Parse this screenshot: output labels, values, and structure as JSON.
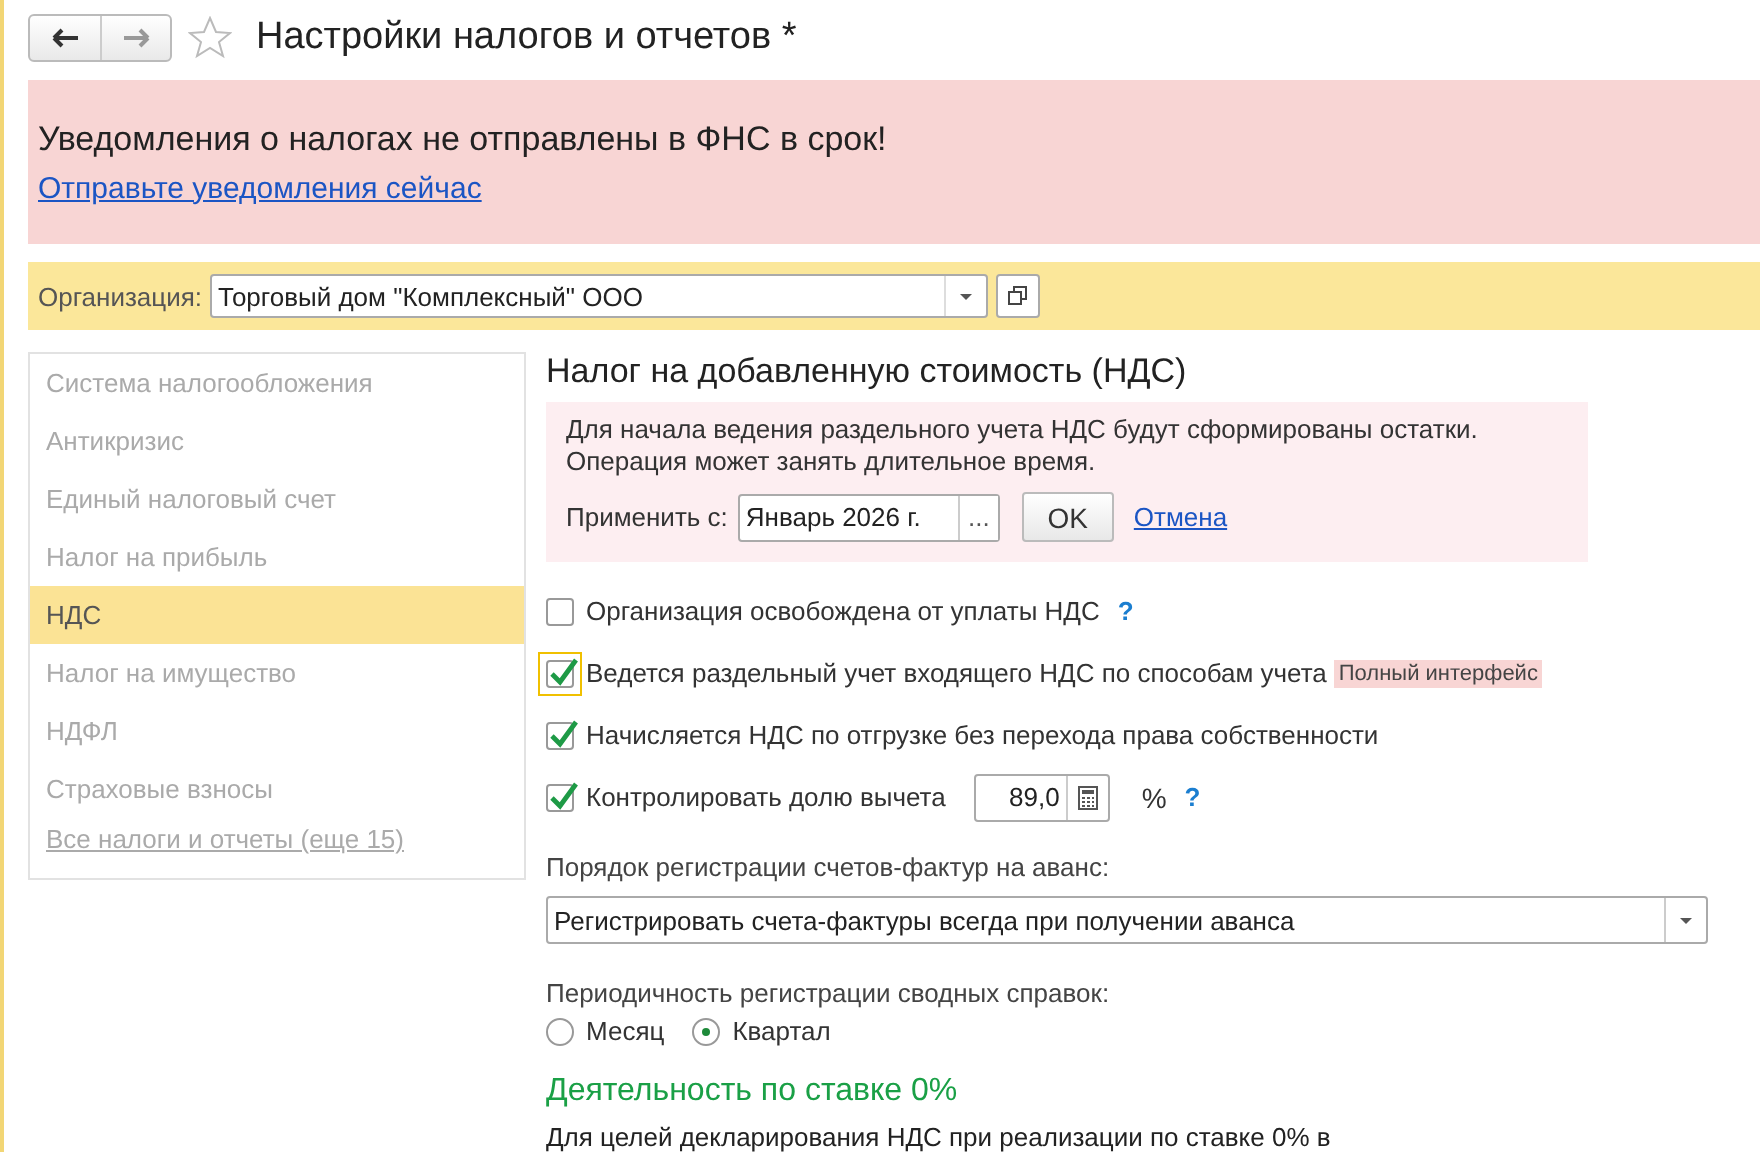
{
  "window": {
    "title": "Настройки налогов и отчетов *"
  },
  "alert": {
    "message": "Уведомления о налогах не отправлены в ФНС в срок!",
    "link": "Отправьте уведомления сейчас"
  },
  "organization": {
    "label": "Организация:",
    "value": "Торговый дом \"Комплексный\" ООО"
  },
  "sidebar": {
    "items": [
      {
        "label": "Система налогообложения",
        "selected": false
      },
      {
        "label": "Антикризис",
        "selected": false
      },
      {
        "label": "Единый налоговый счет",
        "selected": false
      },
      {
        "label": "Налог на прибыль",
        "selected": false
      },
      {
        "label": "НДС",
        "selected": true
      },
      {
        "label": "Налог на имущество",
        "selected": false
      },
      {
        "label": "НДФЛ",
        "selected": false
      },
      {
        "label": "Страховые взносы",
        "selected": false
      }
    ],
    "more_link": "Все налоги и отчеты (еще 15)"
  },
  "section": {
    "title": "Налог на добавленную стоимость (НДС)",
    "notice": {
      "lines": [
        "Для начала ведения раздельного учета НДС будут сформированы остатки.",
        "Операция может занять длительное время."
      ],
      "apply_label": "Применить с:",
      "apply_value": "Январь 2026 г.",
      "choose_button": "...",
      "ok_button": "OK",
      "cancel_link": "Отмена"
    },
    "options": [
      {
        "label": "Организация освобождена от уплаты НДС",
        "checked": false,
        "focused": false,
        "help": "?"
      },
      {
        "label": "Ведется раздельный учет входящего НДС по способам учета",
        "checked": true,
        "focused": true,
        "tag": "Полный интерфейс"
      },
      {
        "label": "Начисляется НДС по отгрузке без перехода права собственности",
        "checked": true,
        "focused": false
      },
      {
        "label": "Контролировать долю вычета",
        "checked": true,
        "focused": false,
        "value": "89,0",
        "unit": "%",
        "help": "?"
      }
    ],
    "invoice_order": {
      "label": "Порядок регистрации счетов-фактур на аванс:",
      "value": "Регистрировать счета-фактуры всегда при получении аванса"
    },
    "summary_period": {
      "label": "Периодичность регистрации сводных справок:",
      "options": [
        {
          "label": "Месяц",
          "selected": false
        },
        {
          "label": "Квартал",
          "selected": true
        }
      ]
    },
    "zero_rate": {
      "title": "Деятельность по ставке 0%",
      "text": "Для целей декларирования НДС при реализации по ставке 0% в"
    }
  }
}
